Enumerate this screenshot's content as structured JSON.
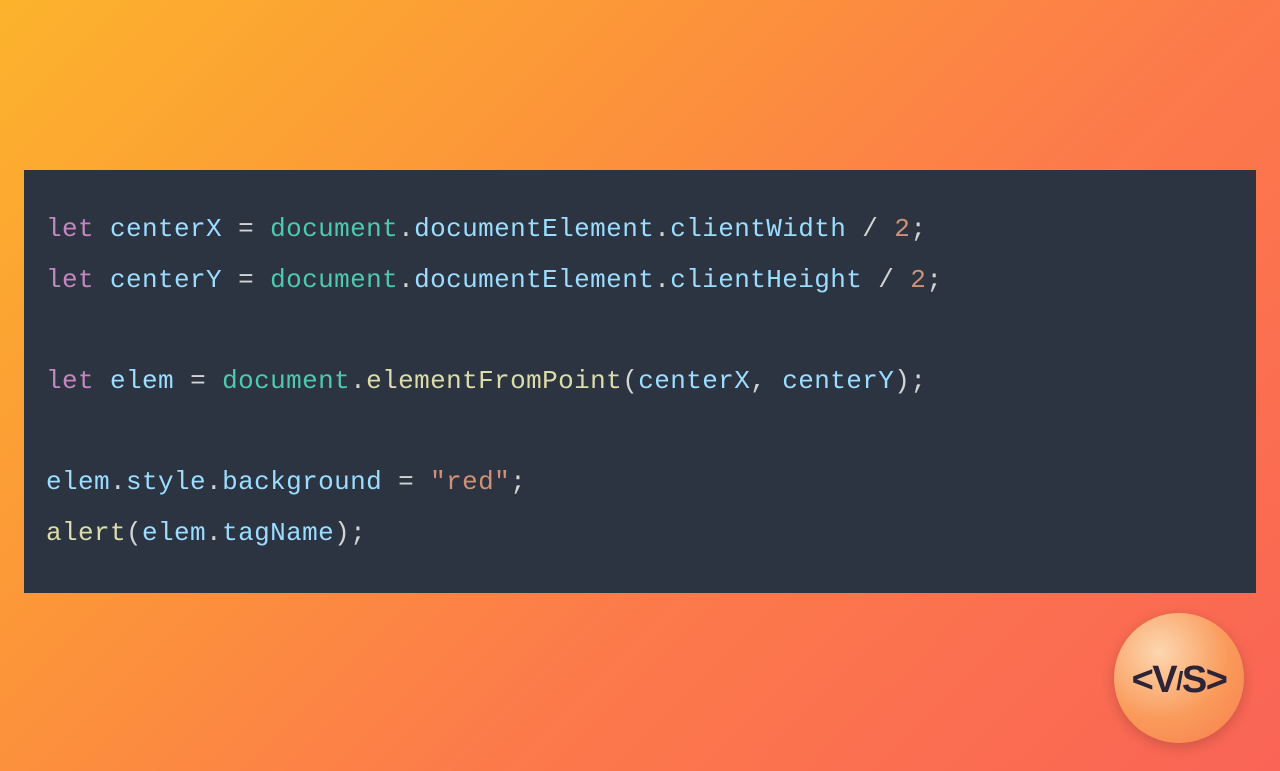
{
  "code": {
    "lines": [
      {
        "tokens": [
          {
            "text": "let",
            "class": "tok-keyword"
          },
          {
            "text": " ",
            "class": "tok-ident"
          },
          {
            "text": "centerX",
            "class": "tok-prop"
          },
          {
            "text": " ",
            "class": "tok-ident"
          },
          {
            "text": "=",
            "class": "tok-punct"
          },
          {
            "text": " ",
            "class": "tok-ident"
          },
          {
            "text": "document",
            "class": "tok-object"
          },
          {
            "text": ".",
            "class": "tok-punct"
          },
          {
            "text": "documentElement",
            "class": "tok-prop"
          },
          {
            "text": ".",
            "class": "tok-punct"
          },
          {
            "text": "clientWidth",
            "class": "tok-prop"
          },
          {
            "text": " ",
            "class": "tok-ident"
          },
          {
            "text": "/",
            "class": "tok-punct"
          },
          {
            "text": " ",
            "class": "tok-ident"
          },
          {
            "text": "2",
            "class": "tok-number"
          },
          {
            "text": ";",
            "class": "tok-punct"
          }
        ]
      },
      {
        "tokens": [
          {
            "text": "let",
            "class": "tok-keyword"
          },
          {
            "text": " ",
            "class": "tok-ident"
          },
          {
            "text": "centerY",
            "class": "tok-prop"
          },
          {
            "text": " ",
            "class": "tok-ident"
          },
          {
            "text": "=",
            "class": "tok-punct"
          },
          {
            "text": " ",
            "class": "tok-ident"
          },
          {
            "text": "document",
            "class": "tok-object"
          },
          {
            "text": ".",
            "class": "tok-punct"
          },
          {
            "text": "documentElement",
            "class": "tok-prop"
          },
          {
            "text": ".",
            "class": "tok-punct"
          },
          {
            "text": "clientHeight",
            "class": "tok-prop"
          },
          {
            "text": " ",
            "class": "tok-ident"
          },
          {
            "text": "/",
            "class": "tok-punct"
          },
          {
            "text": " ",
            "class": "tok-ident"
          },
          {
            "text": "2",
            "class": "tok-number"
          },
          {
            "text": ";",
            "class": "tok-punct"
          }
        ]
      },
      {
        "tokens": []
      },
      {
        "tokens": [
          {
            "text": "let",
            "class": "tok-keyword"
          },
          {
            "text": " ",
            "class": "tok-ident"
          },
          {
            "text": "elem",
            "class": "tok-prop"
          },
          {
            "text": " ",
            "class": "tok-ident"
          },
          {
            "text": "=",
            "class": "tok-punct"
          },
          {
            "text": " ",
            "class": "tok-ident"
          },
          {
            "text": "document",
            "class": "tok-object"
          },
          {
            "text": ".",
            "class": "tok-punct"
          },
          {
            "text": "elementFromPoint",
            "class": "tok-method"
          },
          {
            "text": "(",
            "class": "tok-punct"
          },
          {
            "text": "centerX",
            "class": "tok-prop"
          },
          {
            "text": ",",
            "class": "tok-punct"
          },
          {
            "text": " ",
            "class": "tok-ident"
          },
          {
            "text": "centerY",
            "class": "tok-prop"
          },
          {
            "text": ")",
            "class": "tok-punct"
          },
          {
            "text": ";",
            "class": "tok-punct"
          }
        ]
      },
      {
        "tokens": []
      },
      {
        "tokens": [
          {
            "text": "elem",
            "class": "tok-prop"
          },
          {
            "text": ".",
            "class": "tok-punct"
          },
          {
            "text": "style",
            "class": "tok-prop"
          },
          {
            "text": ".",
            "class": "tok-punct"
          },
          {
            "text": "background",
            "class": "tok-prop"
          },
          {
            "text": " ",
            "class": "tok-ident"
          },
          {
            "text": "=",
            "class": "tok-punct"
          },
          {
            "text": " ",
            "class": "tok-ident"
          },
          {
            "text": "\"red\"",
            "class": "tok-string"
          },
          {
            "text": ";",
            "class": "tok-punct"
          }
        ]
      },
      {
        "tokens": [
          {
            "text": "alert",
            "class": "tok-func"
          },
          {
            "text": "(",
            "class": "tok-punct"
          },
          {
            "text": "elem",
            "class": "tok-prop"
          },
          {
            "text": ".",
            "class": "tok-punct"
          },
          {
            "text": "tagName",
            "class": "tok-prop"
          },
          {
            "text": ")",
            "class": "tok-punct"
          },
          {
            "text": ";",
            "class": "tok-punct"
          }
        ]
      }
    ]
  },
  "logo": {
    "open": "<",
    "v": "V",
    "slash": "/",
    "s": "S",
    "close": ">"
  }
}
